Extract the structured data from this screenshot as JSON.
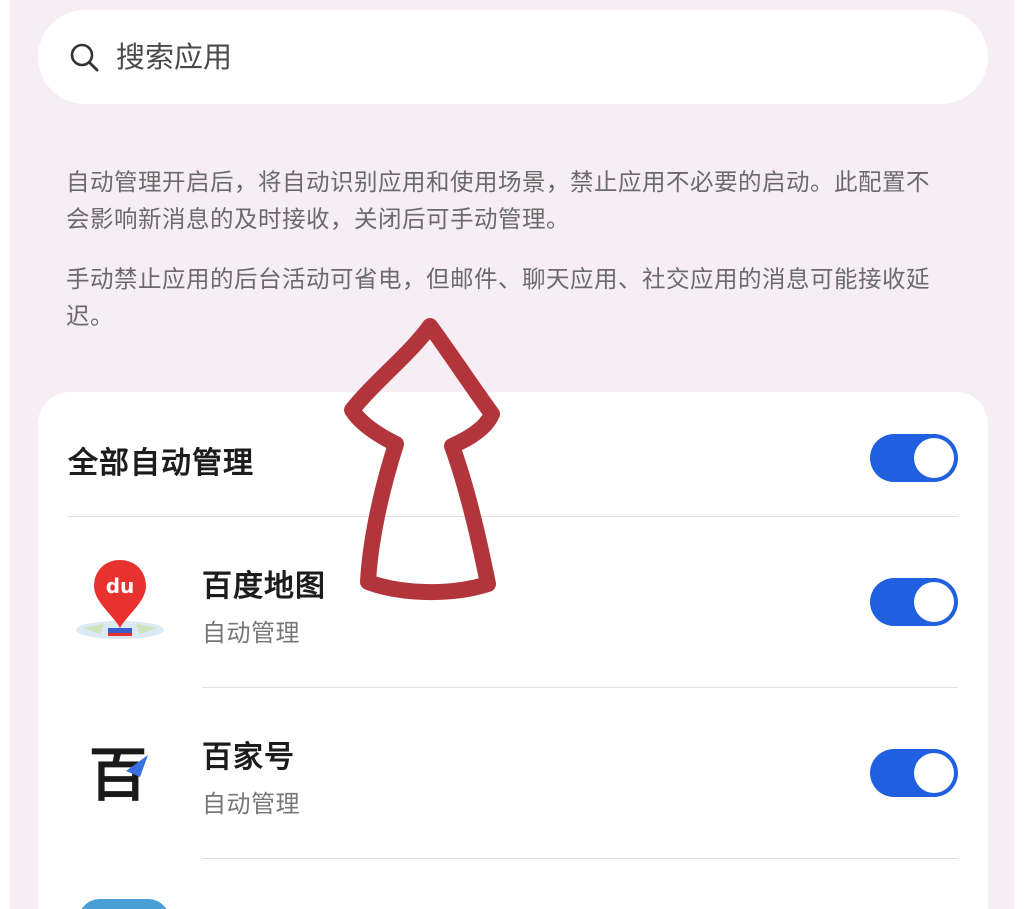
{
  "search": {
    "placeholder": "搜索应用",
    "value": ""
  },
  "description": {
    "paragraph_1": "自动管理开启后，将自动识别应用和使用场景，禁止应用不必要的启动。此配置不会影响新消息的及时接收，关闭后可手动管理。",
    "paragraph_2": "手动禁止应用的后台活动可省电，但邮件、聊天应用、社交应用的消息可能接收延迟。"
  },
  "master_toggle": {
    "label": "全部自动管理",
    "on": true
  },
  "apps": [
    {
      "name": "百度地图",
      "status": "自动管理",
      "icon": "baidu-maps-icon",
      "icon_text": "du",
      "on": true
    },
    {
      "name": "百家号",
      "status": "自动管理",
      "icon": "baijiahao-icon",
      "icon_text": "百",
      "on": true
    }
  ],
  "colors": {
    "background": "#f6eef4",
    "card": "#ffffff",
    "toggle_on": "#1f5fe0",
    "annotation_arrow": "#b3353c",
    "baidu_maps_pin": "#e8322e"
  }
}
